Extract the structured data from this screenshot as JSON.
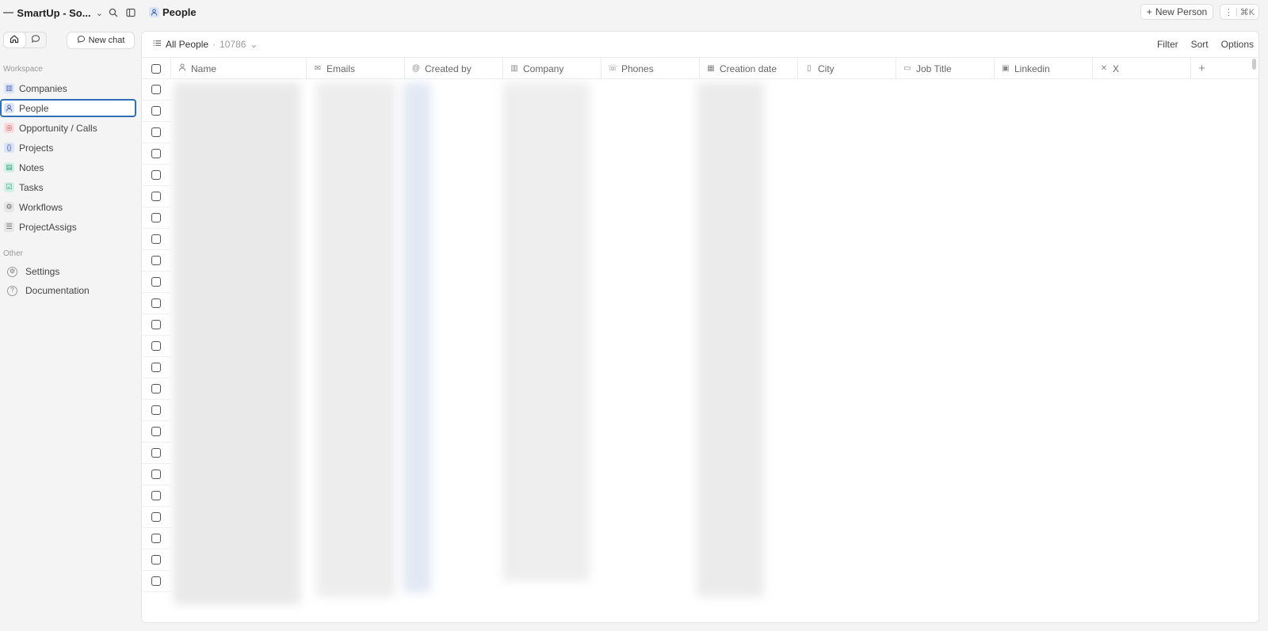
{
  "workspace": {
    "name": "SmartUp - So..."
  },
  "sidebar": {
    "new_chat_label": "New chat",
    "workspace_label": "Workspace",
    "other_label": "Other",
    "items": [
      {
        "label": "Companies",
        "icon": "building-icon",
        "color": "#6b7fd4"
      },
      {
        "label": "People",
        "icon": "person-icon",
        "color": "#6b7fd4",
        "active": true
      },
      {
        "label": "Opportunity / Calls",
        "icon": "target-icon",
        "color": "#e0525a"
      },
      {
        "label": "Projects",
        "icon": "braces-icon",
        "color": "#6b7fd4"
      },
      {
        "label": "Notes",
        "icon": "note-icon",
        "color": "#2a9d7a"
      },
      {
        "label": "Tasks",
        "icon": "checkbox-icon",
        "color": "#2a9d7a"
      },
      {
        "label": "Workflows",
        "icon": "workflow-icon",
        "color": "#888888"
      },
      {
        "label": "ProjectAssigs",
        "icon": "list-icon",
        "color": "#888888"
      }
    ],
    "other_items": [
      {
        "label": "Settings",
        "icon": "gear-icon"
      },
      {
        "label": "Documentation",
        "icon": "help-icon"
      }
    ]
  },
  "topbar": {
    "breadcrumb": "People",
    "new_person_label": "New Person",
    "shortcut": "⌘K"
  },
  "view": {
    "name": "All People",
    "count": "10786",
    "filter_label": "Filter",
    "sort_label": "Sort",
    "options_label": "Options"
  },
  "table": {
    "columns": [
      {
        "label": "Name",
        "icon": "person-icon"
      },
      {
        "label": "Emails",
        "icon": "mail-icon"
      },
      {
        "label": "Created by",
        "icon": "at-icon"
      },
      {
        "label": "Company",
        "icon": "building-icon"
      },
      {
        "label": "Phones",
        "icon": "phone-icon"
      },
      {
        "label": "Creation date",
        "icon": "calendar-icon"
      },
      {
        "label": "City",
        "icon": "map-icon"
      },
      {
        "label": "Job Title",
        "icon": "briefcase-icon"
      },
      {
        "label": "Linkedin",
        "icon": "linkedin-icon"
      },
      {
        "label": "X",
        "icon": "x-icon"
      }
    ]
  },
  "colors": {
    "accent": "#2f6fb4",
    "panel_bg": "#ffffff",
    "page_bg": "#f4f4f4"
  }
}
